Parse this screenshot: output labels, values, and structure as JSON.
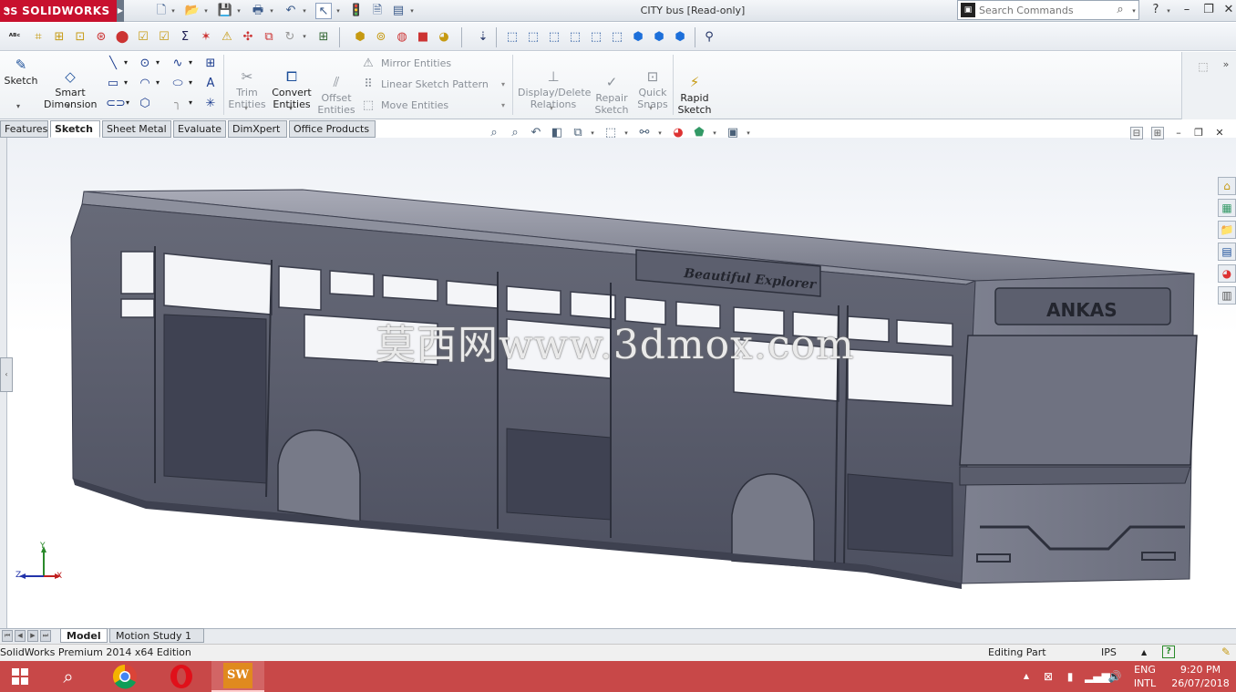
{
  "app": {
    "brand": "SOLIDWORKS",
    "document_title": "CITY bus [Read-only]"
  },
  "search": {
    "placeholder": "Search Commands"
  },
  "command_manager": {
    "sketch_label": "Sketch",
    "smart_dimension_label": "Smart\nDimension",
    "trim_label": "Trim\nEntities",
    "convert_label": "Convert\nEntities",
    "offset_label": "Offset\nEntities",
    "mirror_label": "Mirror Entities",
    "linear_pattern_label": "Linear Sketch Pattern",
    "move_label": "Move Entities",
    "display_delete_label": "Display/Delete\nRelations",
    "repair_label": "Repair\nSketch",
    "quick_snaps_label": "Quick\nSnaps",
    "rapid_sketch_label": "Rapid\nSketch"
  },
  "tabs": [
    {
      "label": "Features"
    },
    {
      "label": "Sketch"
    },
    {
      "label": "Sheet Metal"
    },
    {
      "label": "Evaluate"
    },
    {
      "label": "DimXpert"
    },
    {
      "label": "Office Products"
    }
  ],
  "active_tab": "Sketch",
  "model": {
    "destination_sign": "Beautiful Explorer",
    "front_logo": "ANKAS",
    "watermark": "莫西网www.3dmox.com",
    "body_color": "#5c5f6e"
  },
  "triad": {
    "x": "X",
    "y": "Y",
    "z": "Z"
  },
  "model_tabs": [
    {
      "label": "Model"
    },
    {
      "label": "Motion Study 1"
    }
  ],
  "status": {
    "edition": "SolidWorks Premium 2014 x64 Edition",
    "mode": "Editing Part",
    "units": "IPS"
  },
  "taskbar": {
    "lang_top": "ENG",
    "lang_bottom": "INTL",
    "time": "9:20 PM",
    "date": "26/07/2018"
  },
  "colors": {
    "brand_red": "#c8102e",
    "taskbar": "#c84848"
  }
}
